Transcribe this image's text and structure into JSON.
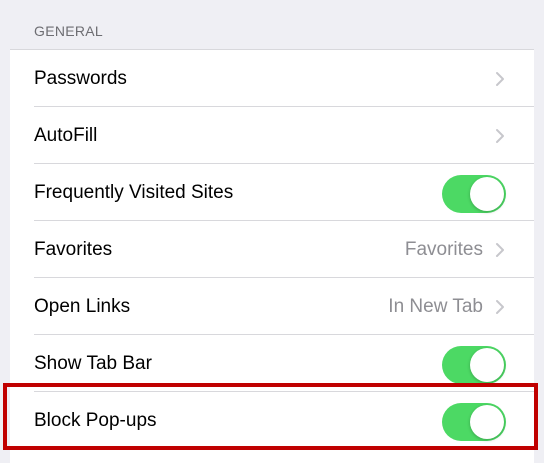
{
  "section": {
    "header": "GENERAL"
  },
  "rows": [
    {
      "label": "Passwords",
      "control": "chevron"
    },
    {
      "label": "AutoFill",
      "control": "chevron"
    },
    {
      "label": "Frequently Visited Sites",
      "control": "toggle",
      "on": true
    },
    {
      "label": "Favorites",
      "value": "Favorites",
      "control": "chevron"
    },
    {
      "label": "Open Links",
      "value": "In New Tab",
      "control": "chevron"
    },
    {
      "label": "Show Tab Bar",
      "control": "toggle",
      "on": true
    },
    {
      "label": "Block Pop-ups",
      "control": "toggle",
      "on": true,
      "highlighted": true
    }
  ],
  "colors": {
    "toggle_on": "#4cd964",
    "highlight_border": "#c00000",
    "secondary_text": "#8e8e93",
    "header_text": "#6d6d72",
    "background": "#efeff4"
  },
  "icons": [
    "chevron-right-icon"
  ]
}
